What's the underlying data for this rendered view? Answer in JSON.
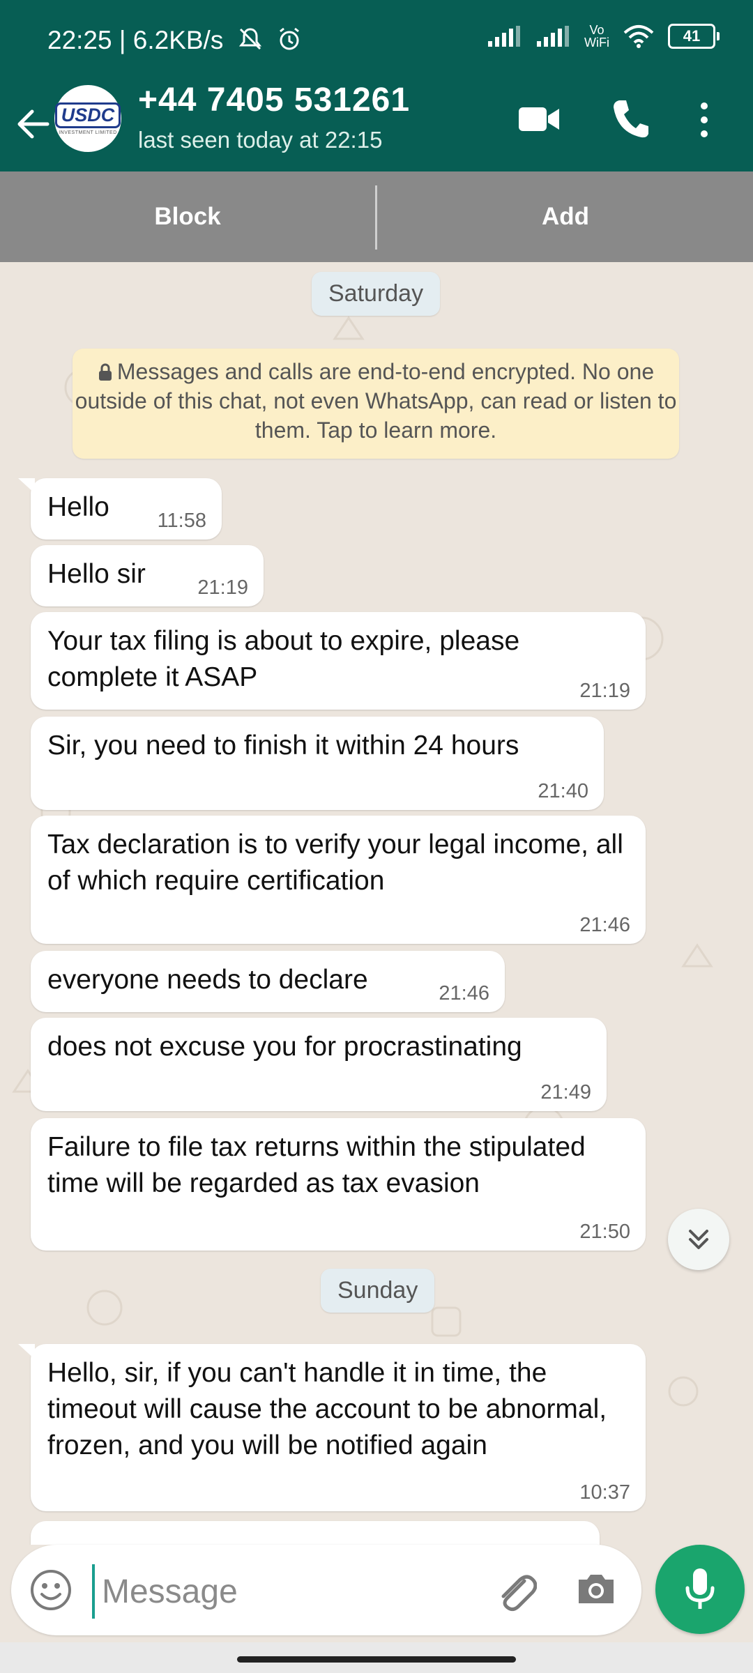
{
  "status_bar": {
    "time": "22:25",
    "net_speed": "6.2KB/s",
    "volte": "Vo",
    "wifi_label": "WiFi",
    "battery": "41"
  },
  "header": {
    "avatar_logo": "USDC",
    "avatar_sub": "INVESTMENT LIMITED",
    "contact": "+44 7405 531261",
    "last_seen": "last seen today at 22:15"
  },
  "actions": {
    "block": "Block",
    "add": "Add"
  },
  "chat": {
    "date_saturday": "Saturday",
    "encryption_notice": "Messages and calls are end-to-end encrypted. No one outside of this chat, not even WhatsApp, can read or listen to them. Tap to learn more.",
    "date_sunday": "Sunday",
    "messages": [
      {
        "text": "Hello",
        "time": "11:58"
      },
      {
        "text": "Hello sir",
        "time": "21:19"
      },
      {
        "text": "Your tax filing is about to expire, please complete it ASAP",
        "time": "21:19"
      },
      {
        "text": "Sir, you need to finish it within 24 hours",
        "time": "21:40"
      },
      {
        "text": "Tax declaration is to verify your legal income, all of which require certification",
        "time": "21:46"
      },
      {
        "text": "everyone needs to declare",
        "time": "21:46"
      },
      {
        "text": "does not excuse you for procrastinating",
        "time": "21:49"
      },
      {
        "text": "Failure to file tax returns within the stipulated time will be regarded as tax evasion",
        "time": "21:50"
      },
      {
        "text": "Hello, sir, if you can't handle it in time, the timeout will cause the account to be abnormal, frozen, and you will be notified again",
        "time": "10:37"
      }
    ]
  },
  "input": {
    "placeholder": "Message"
  },
  "colors": {
    "header": "#075e54",
    "accent": "#1aa56d",
    "chat_bg": "#ece5dd",
    "action_bar": "#898989"
  }
}
